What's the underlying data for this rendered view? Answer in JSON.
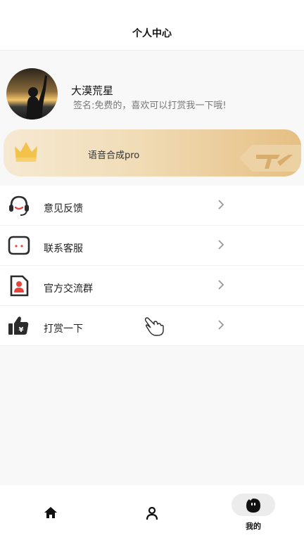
{
  "header": {
    "title": "个人中心"
  },
  "profile": {
    "avatar_icon": "avatar-silhouette-sunset",
    "username": "大漠荒星",
    "signature": "签名:免费的，喜欢可以打赏我一下哦!"
  },
  "pro_banner": {
    "label": "语音合成pro",
    "crown_icon": "crown-icon",
    "colors": {
      "start": "#f6e9d2",
      "end": "#e6bf83"
    }
  },
  "menu": {
    "items": [
      {
        "label": "意见反馈",
        "icon": "headset-icon"
      },
      {
        "label": "联系客服",
        "icon": "chat-bubble-icon"
      },
      {
        "label": "官方交流群",
        "icon": "contact-card-icon"
      },
      {
        "label": "打赏一下",
        "icon": "thumbs-up-yuan-icon"
      }
    ]
  },
  "tabbar": {
    "tabs": [
      {
        "label": "",
        "icon": "home-icon",
        "active": false
      },
      {
        "label": "",
        "icon": "user-icon",
        "active": false
      },
      {
        "label": "我的",
        "icon": "mine-face-icon",
        "active": true
      }
    ]
  },
  "colors": {
    "accent_red": "#e8433a",
    "icon_dark": "#2b2b2b"
  }
}
